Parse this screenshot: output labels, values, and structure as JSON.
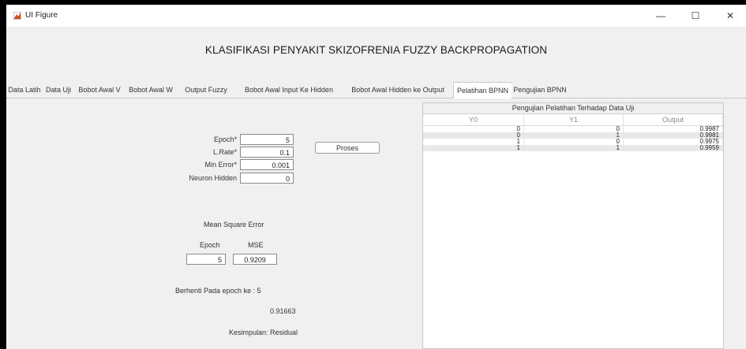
{
  "window": {
    "title": "UI Figure",
    "controls": {
      "minimize": "—",
      "maximize": "☐",
      "close": "✕"
    }
  },
  "heading": "KLASIFIKASI PENYAKIT SKIZOFRENIA FUZZY BACKPROPAGATION",
  "tabs": [
    {
      "label": "Data Latih"
    },
    {
      "label": "Data Uji"
    },
    {
      "label": "Bobot Awal V"
    },
    {
      "label": "Bobot Awal W"
    },
    {
      "label": "Output Fuzzy"
    },
    {
      "label": "Bobot Awal Input Ke Hidden"
    },
    {
      "label": "Bobot Awal Hidden ke Output"
    },
    {
      "label": "Pelatihan BPNN"
    },
    {
      "label": "Pengujian BPNN"
    }
  ],
  "active_tab": "Pelatihan BPNN",
  "form": {
    "epoch_label": "Epoch*",
    "epoch_value": "5",
    "lrate_label": "L.Rate*",
    "lrate_value": "0.1",
    "minerror_label": "Min Error*",
    "minerror_value": "0.001",
    "neuron_label": "Neuron Hidden",
    "neuron_value": "0",
    "proses_button": "Proses"
  },
  "mse": {
    "title": "Mean Square Error",
    "epoch_label": "Epoch",
    "mse_label": "MSE",
    "epoch_value": "5",
    "mse_value": "0.9209"
  },
  "result": {
    "stop_text": "Berhenti Pada epoch ke :  5",
    "value": "0.91663",
    "conclusion": "Kesimpulan:  Residual"
  },
  "table": {
    "title": "Pengujian Pelatihan Terhadap Data Uji",
    "columns": [
      "Y0",
      "Y1",
      "Output"
    ],
    "rows": [
      [
        "0",
        "0",
        "0.9987"
      ],
      [
        "0",
        "1",
        "0.9981"
      ],
      [
        "1",
        "0",
        "0.9975"
      ],
      [
        "1",
        "1",
        "0.9959"
      ]
    ]
  }
}
